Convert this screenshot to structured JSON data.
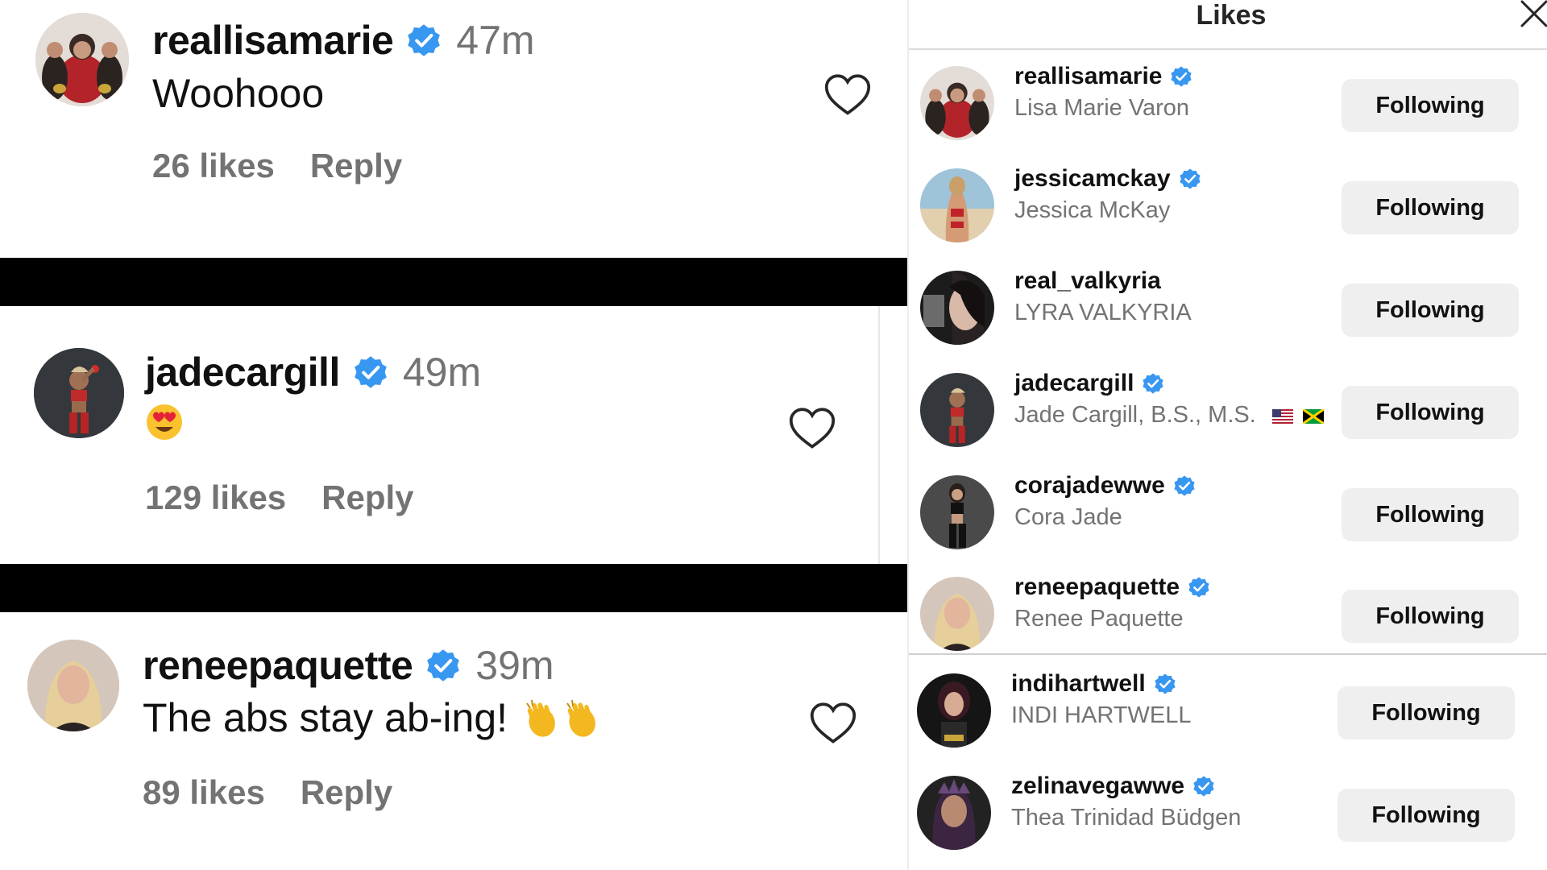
{
  "comments": [
    {
      "username": "reallisamarie",
      "time": "47m",
      "text": "Woohooo",
      "emoji": "",
      "likes": "26 likes",
      "reply": "Reply"
    },
    {
      "username": "jadecargill",
      "time": "49m",
      "text": "",
      "emoji": "heart-eyes",
      "likes": "129 likes",
      "reply": "Reply"
    },
    {
      "username": "reneepaquette",
      "time": "39m",
      "text": "The abs stay ab-ing!",
      "emoji": "clapping-hands",
      "likes": "89 likes",
      "reply": "Reply"
    }
  ],
  "likes_panel": {
    "title": "Likes",
    "button_label": "Following",
    "users": [
      {
        "username": "reallisamarie",
        "full_name": "Lisa Marie Varon",
        "verified": true
      },
      {
        "username": "jessicamckay",
        "full_name": "Jessica McKay",
        "verified": true
      },
      {
        "username": "real_valkyria",
        "full_name": "LYRA VALKYRIA",
        "verified": false
      },
      {
        "username": "jadecargill",
        "full_name": "Jade Cargill, B.S., M.S.",
        "verified": true,
        "flags": [
          "us-flag",
          "jamaica-flag"
        ]
      },
      {
        "username": "corajadewwe",
        "full_name": "Cora Jade",
        "verified": true
      },
      {
        "username": "reneepaquette",
        "full_name": "Renee Paquette",
        "verified": true
      },
      {
        "username": "indihartwell",
        "full_name": "INDI HARTWELL",
        "verified": true
      },
      {
        "username": "zelinavegawwe",
        "full_name": "Thea Trinidad Büdgen",
        "verified": true
      }
    ]
  },
  "colors": {
    "verified": "#3897f0",
    "muted_text": "#737373",
    "button_bg": "#efefef",
    "separator": "#000000"
  }
}
